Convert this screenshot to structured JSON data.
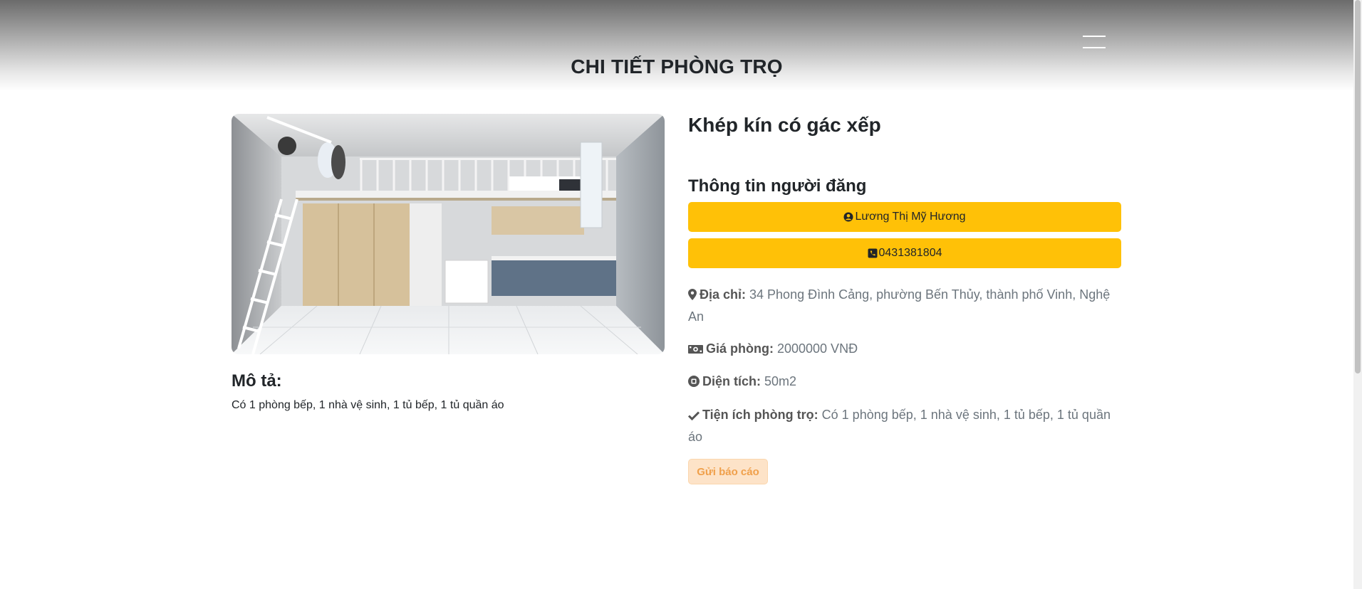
{
  "header": {
    "title": "CHI TIẾT PHÒNG TRỌ",
    "menu_icon": "hamburger-icon"
  },
  "room": {
    "title": "Khép kín có gác xếp",
    "image_icon": "room-photo"
  },
  "description": {
    "heading": "Mô tả:",
    "text": "Có 1 phòng bếp, 1 nhà vệ sinh, 1 tủ bếp, 1 tủ quần áo"
  },
  "poster": {
    "heading": "Thông tin người đăng",
    "name": "Lương Thị Mỹ Hương",
    "name_icon": "user-circle-icon",
    "phone": "0431381804",
    "phone_icon": "phone-icon",
    "button_color": "#ffc107"
  },
  "details": {
    "address_label": "Địa chỉ:",
    "address_value": " 34 Phong Đình Cảng, phường Bến Thủy, thành phố Vinh, Nghệ An",
    "address_icon": "map-marker-icon",
    "price_label": "Giá phòng:",
    "price_value": " 2000000 VNĐ",
    "price_icon": "money-bill-icon",
    "area_label": "Diện tích:",
    "area_value": " 50m2",
    "area_icon": "area-icon",
    "amenities_label": "Tiện ích phòng trọ:",
    "amenities_value": " Có 1 phòng bếp, 1 nhà vệ sinh, 1 tủ bếp, 1 tủ quần áo",
    "amenities_icon": "check-icon"
  },
  "actions": {
    "report_label": "Gửi báo cáo",
    "report_color": "#f0a04b"
  }
}
